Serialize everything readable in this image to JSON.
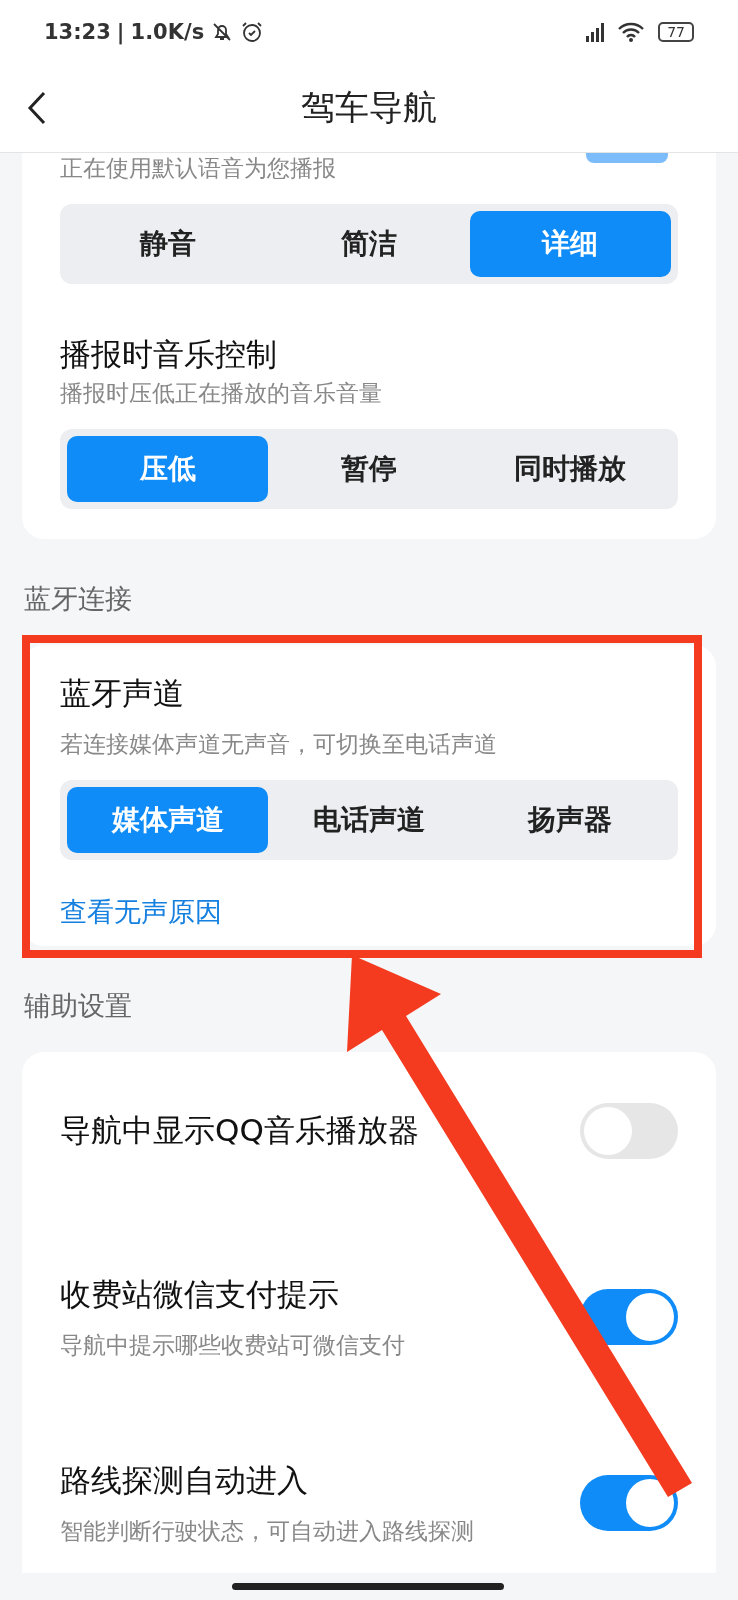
{
  "status_bar": {
    "time": "13:23",
    "separator": "|",
    "speed": "1.0K/s",
    "battery": "77"
  },
  "header": {
    "title": "驾车导航"
  },
  "voice": {
    "subtitle": "正在使用默认语音为您播报",
    "modes": [
      {
        "label": "静音",
        "selected": false
      },
      {
        "label": "简洁",
        "selected": false
      },
      {
        "label": "详细",
        "selected": true
      }
    ],
    "music_title": "播报时音乐控制",
    "music_desc": "播报时压低正在播放的音乐音量",
    "music_modes": [
      {
        "label": "压低",
        "selected": true
      },
      {
        "label": "暂停",
        "selected": false
      },
      {
        "label": "同时播放",
        "selected": false
      }
    ]
  },
  "bluetooth": {
    "section_label": "蓝牙连接",
    "title": "蓝牙声道",
    "desc": "若连接媒体声道无声音，可切换至电话声道",
    "channels": [
      {
        "label": "媒体声道",
        "selected": true
      },
      {
        "label": "电话声道",
        "selected": false
      },
      {
        "label": "扬声器",
        "selected": false
      }
    ],
    "link": "查看无声原因",
    "annotated": true
  },
  "assist": {
    "section_label": "辅助设置",
    "rows": [
      {
        "title": "导航中显示QQ音乐播放器",
        "on": false
      },
      {
        "title": "收费站微信支付提示",
        "desc": "导航中提示哪些收费站可微信支付",
        "on": true
      },
      {
        "title": "路线探测自动进入",
        "desc": "智能判断行驶状态，可自动进入路线探测",
        "on": true
      }
    ]
  }
}
